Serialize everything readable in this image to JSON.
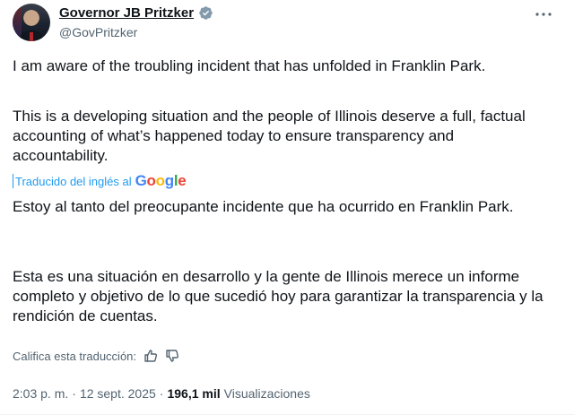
{
  "author": {
    "display_name": "Governor JB Pritzker",
    "handle": "@GovPritzker",
    "verified_icon": "verified-badge-icon",
    "more_icon": "more-options-icon"
  },
  "tweet": {
    "paragraph_1": "I am aware of the troubling incident that has unfolded in Franklin Park.",
    "paragraph_2": "This is a developing situation and the people of Illinois deserve a full, factual accounting of what’s happened today to ensure transparency and accountability."
  },
  "translation": {
    "label": "Traducido del inglés al",
    "provider": "Google",
    "paragraph_1": "Estoy al tanto del preocupante incidente que ha ocurrido en Franklin Park.",
    "paragraph_2": "Esta es una situación en desarrollo y la gente de Illinois merece un informe completo y objetivo de lo que sucedió hoy para garantizar la transparencia y la rendición de cuentas.",
    "rate_label": "Califica esta traducción:",
    "thumbs_up_icon": "thumbs-up-icon",
    "thumbs_down_icon": "thumbs-down-icon"
  },
  "meta": {
    "time": "2:03 p. m.",
    "separator": "·",
    "date": "12 sept. 2025",
    "views_count": "196,1 mil",
    "views_label": "Visualizaciones"
  },
  "colors": {
    "text": "#0f1419",
    "secondary": "#536471",
    "accent": "#1d9bf0"
  }
}
